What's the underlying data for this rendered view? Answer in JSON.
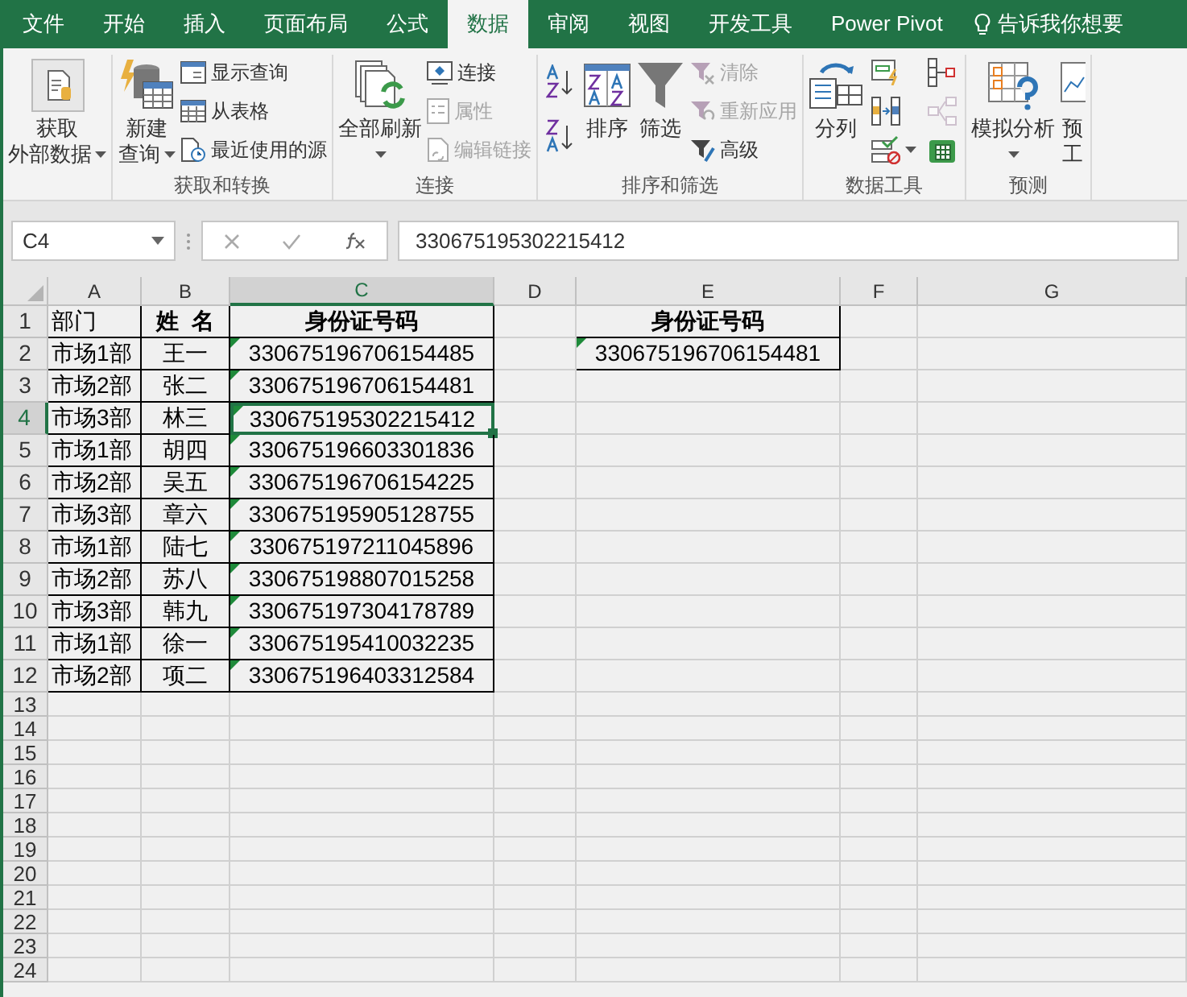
{
  "tabs": [
    {
      "label": "文件",
      "selected": false
    },
    {
      "label": "开始",
      "selected": false
    },
    {
      "label": "插入",
      "selected": false
    },
    {
      "label": "页面布局",
      "selected": false
    },
    {
      "label": "公式",
      "selected": false
    },
    {
      "label": "数据",
      "selected": true
    },
    {
      "label": "审阅",
      "selected": false
    },
    {
      "label": "视图",
      "selected": false
    },
    {
      "label": "开发工具",
      "selected": false
    },
    {
      "label": "Power Pivot",
      "selected": false
    }
  ],
  "tell_me": "告诉我你想要",
  "ribbon": [
    {
      "columns": [
        [
          {
            "kind": "large",
            "lines": [
              "获取",
              "外部数据"
            ],
            "dropdown": true,
            "disabled": false
          }
        ]
      ]
    },
    {
      "label": "获取和转换",
      "columns": [
        [
          {
            "kind": "large",
            "lines": [
              "新建",
              "查询"
            ],
            "dropdown": true,
            "disabled": false
          }
        ],
        [
          {
            "kind": "small",
            "label": "显示查询",
            "disabled": false
          },
          {
            "kind": "small",
            "label": "从表格",
            "disabled": false
          },
          {
            "kind": "small",
            "label": "最近使用的源",
            "disabled": false
          }
        ]
      ]
    },
    {
      "label": "连接",
      "columns": [
        [
          {
            "kind": "large",
            "lines": [
              "全部刷新"
            ],
            "dropdown": true,
            "disabled": false
          }
        ],
        [
          {
            "kind": "small",
            "label": "连接",
            "disabled": false
          },
          {
            "kind": "small",
            "label": "属性",
            "disabled": true
          },
          {
            "kind": "small",
            "label": "编辑链接",
            "disabled": true
          }
        ]
      ]
    },
    {
      "label": "排序和筛选",
      "columns": [
        [
          {
            "kind": "icon",
            "disabled": false
          },
          {
            "kind": "icon",
            "disabled": false
          }
        ],
        [
          {
            "kind": "large",
            "lines": [
              "排序"
            ],
            "dropdown": false,
            "disabled": false
          }
        ],
        [
          {
            "kind": "large",
            "lines": [
              "筛选"
            ],
            "dropdown": false,
            "disabled": false
          }
        ],
        [
          {
            "kind": "small",
            "label": "清除",
            "disabled": true
          },
          {
            "kind": "small",
            "label": "重新应用",
            "disabled": true
          },
          {
            "kind": "small",
            "label": "高级",
            "disabled": false
          }
        ]
      ]
    },
    {
      "label": "数据工具",
      "columns": [
        [
          {
            "kind": "large",
            "lines": [
              "分列"
            ],
            "dropdown": false,
            "disabled": false
          }
        ],
        [
          {
            "kind": "icon",
            "disabled": false
          },
          {
            "kind": "icon",
            "disabled": false
          },
          {
            "kind": "icon",
            "disabled": false,
            "dropdown": true
          }
        ],
        [
          {
            "kind": "icon",
            "disabled": false
          },
          {
            "kind": "icon",
            "disabled": true
          },
          {
            "kind": "icon",
            "disabled": false
          }
        ]
      ]
    },
    {
      "label": "预测",
      "columns": [
        [
          {
            "kind": "large",
            "lines": [
              "模拟分析"
            ],
            "dropdown": true,
            "disabled": false
          }
        ],
        [
          {
            "kind": "large",
            "lines": [
              "预",
              "工"
            ],
            "dropdown": false,
            "disabled": false
          }
        ]
      ]
    }
  ],
  "name_box": "C4",
  "formula": "330675195302215412",
  "columns": [
    {
      "label": "A",
      "selected": false
    },
    {
      "label": "B",
      "selected": false
    },
    {
      "label": "C",
      "selected": true
    },
    {
      "label": "D",
      "selected": false
    },
    {
      "label": "E",
      "selected": false
    },
    {
      "label": "F",
      "selected": false
    },
    {
      "label": "G",
      "selected": false
    }
  ],
  "rows": [
    {
      "label": "1",
      "selected": false,
      "cells": {
        "A": {
          "text": "部门",
          "bold": false,
          "flagged": false,
          "selected": false
        },
        "B": {
          "text": "姓  名",
          "bold": true,
          "flagged": false,
          "selected": false
        },
        "C": {
          "text": "身份证号码",
          "bold": true,
          "flagged": false,
          "selected": false
        },
        "E": {
          "text": "身份证号码",
          "bold": true,
          "flagged": false,
          "selected": false
        }
      }
    },
    {
      "label": "2",
      "selected": false,
      "cells": {
        "A": {
          "text": "市场1部",
          "bold": false,
          "flagged": false,
          "selected": false
        },
        "B": {
          "text": "王一",
          "bold": false,
          "flagged": false,
          "selected": false
        },
        "C": {
          "text": "330675196706154485",
          "bold": false,
          "flagged": true,
          "selected": false
        },
        "E": {
          "text": "330675196706154481",
          "bold": false,
          "flagged": true,
          "selected": false
        }
      }
    },
    {
      "label": "3",
      "selected": false,
      "cells": {
        "A": {
          "text": "市场2部",
          "bold": false,
          "flagged": false,
          "selected": false
        },
        "B": {
          "text": "张二",
          "bold": false,
          "flagged": false,
          "selected": false
        },
        "C": {
          "text": "330675196706154481",
          "bold": false,
          "flagged": true,
          "selected": false
        }
      }
    },
    {
      "label": "4",
      "selected": true,
      "cells": {
        "A": {
          "text": "市场3部",
          "bold": false,
          "flagged": false,
          "selected": false
        },
        "B": {
          "text": "林三",
          "bold": false,
          "flagged": false,
          "selected": false
        },
        "C": {
          "text": "330675195302215412",
          "bold": false,
          "flagged": true,
          "selected": true
        }
      }
    },
    {
      "label": "5",
      "selected": false,
      "cells": {
        "A": {
          "text": "市场1部",
          "bold": false,
          "flagged": false,
          "selected": false
        },
        "B": {
          "text": "胡四",
          "bold": false,
          "flagged": false,
          "selected": false
        },
        "C": {
          "text": "330675196603301836",
          "bold": false,
          "flagged": true,
          "selected": false
        }
      }
    },
    {
      "label": "6",
      "selected": false,
      "cells": {
        "A": {
          "text": "市场2部",
          "bold": false,
          "flagged": false,
          "selected": false
        },
        "B": {
          "text": "吴五",
          "bold": false,
          "flagged": false,
          "selected": false
        },
        "C": {
          "text": "330675196706154225",
          "bold": false,
          "flagged": true,
          "selected": false
        }
      }
    },
    {
      "label": "7",
      "selected": false,
      "cells": {
        "A": {
          "text": "市场3部",
          "bold": false,
          "flagged": false,
          "selected": false
        },
        "B": {
          "text": "章六",
          "bold": false,
          "flagged": false,
          "selected": false
        },
        "C": {
          "text": "330675195905128755",
          "bold": false,
          "flagged": true,
          "selected": false
        }
      }
    },
    {
      "label": "8",
      "selected": false,
      "cells": {
        "A": {
          "text": "市场1部",
          "bold": false,
          "flagged": false,
          "selected": false
        },
        "B": {
          "text": "陆七",
          "bold": false,
          "flagged": false,
          "selected": false
        },
        "C": {
          "text": "330675197211045896",
          "bold": false,
          "flagged": true,
          "selected": false
        }
      }
    },
    {
      "label": "9",
      "selected": false,
      "cells": {
        "A": {
          "text": "市场2部",
          "bold": false,
          "flagged": false,
          "selected": false
        },
        "B": {
          "text": "苏八",
          "bold": false,
          "flagged": false,
          "selected": false
        },
        "C": {
          "text": "330675198807015258",
          "bold": false,
          "flagged": true,
          "selected": false
        }
      }
    },
    {
      "label": "10",
      "selected": false,
      "cells": {
        "A": {
          "text": "市场3部",
          "bold": false,
          "flagged": false,
          "selected": false
        },
        "B": {
          "text": "韩九",
          "bold": false,
          "flagged": false,
          "selected": false
        },
        "C": {
          "text": "330675197304178789",
          "bold": false,
          "flagged": true,
          "selected": false
        }
      }
    },
    {
      "label": "11",
      "selected": false,
      "cells": {
        "A": {
          "text": "市场1部",
          "bold": false,
          "flagged": false,
          "selected": false
        },
        "B": {
          "text": "徐一",
          "bold": false,
          "flagged": false,
          "selected": false
        },
        "C": {
          "text": "330675195410032235",
          "bold": false,
          "flagged": true,
          "selected": false
        }
      }
    },
    {
      "label": "12",
      "selected": false,
      "cells": {
        "A": {
          "text": "市场2部",
          "bold": false,
          "flagged": false,
          "selected": false
        },
        "B": {
          "text": "项二",
          "bold": false,
          "flagged": false,
          "selected": false
        },
        "C": {
          "text": "330675196403312584",
          "bold": false,
          "flagged": true,
          "selected": false
        }
      }
    },
    {
      "label": "13",
      "selected": false
    },
    {
      "label": "14",
      "selected": false
    },
    {
      "label": "15",
      "selected": false
    },
    {
      "label": "16",
      "selected": false
    },
    {
      "label": "17",
      "selected": false
    },
    {
      "label": "18",
      "selected": false
    },
    {
      "label": "19",
      "selected": false
    },
    {
      "label": "20",
      "selected": false
    },
    {
      "label": "21",
      "selected": false
    },
    {
      "label": "22",
      "selected": false
    },
    {
      "label": "23",
      "selected": false
    },
    {
      "label": "24",
      "selected": false
    }
  ]
}
